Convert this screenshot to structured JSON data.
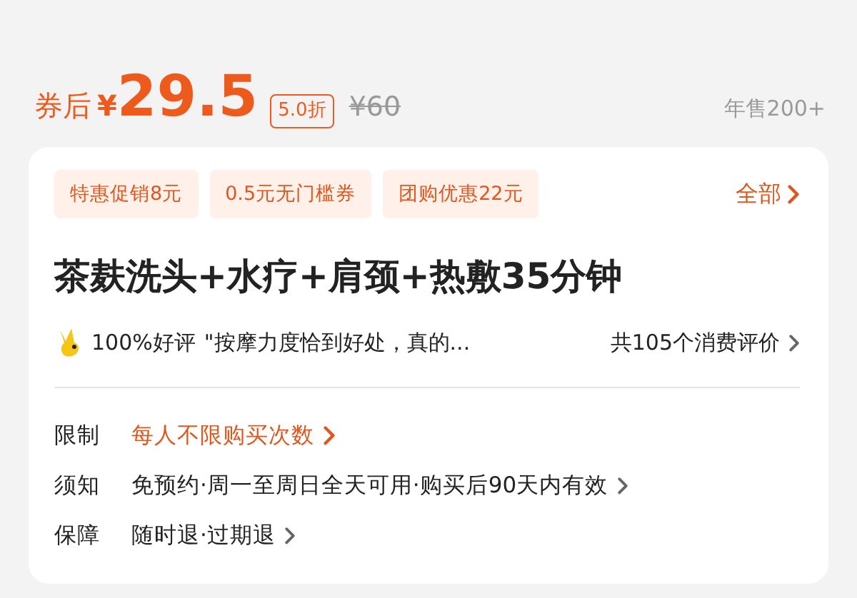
{
  "price": {
    "prefix": "券后",
    "currency": "¥",
    "amount": "29.5",
    "discount": "5.0折",
    "original": "¥60",
    "sales": "年售200+"
  },
  "promos": [
    {
      "label": "特惠促销8元"
    },
    {
      "label": "0.5元无门槛券"
    },
    {
      "label": "团购优惠22元"
    }
  ],
  "promos_more": "全部",
  "title": "茶麸洗头+水疗+肩颈+热敷35分钟",
  "review": {
    "rating": "100%好评",
    "quote": "\"按摩力度恰到好处，真的...",
    "count": "共105个消费评价"
  },
  "info_rows": [
    {
      "label": "限制",
      "value": "每人不限购买次数",
      "kind": "accent"
    },
    {
      "label": "须知",
      "value": "免预约·周一至周日全天可用·购买后90天内有效",
      "kind": "plain"
    },
    {
      "label": "保障",
      "value": "随时退·过期退",
      "kind": "plain"
    }
  ]
}
